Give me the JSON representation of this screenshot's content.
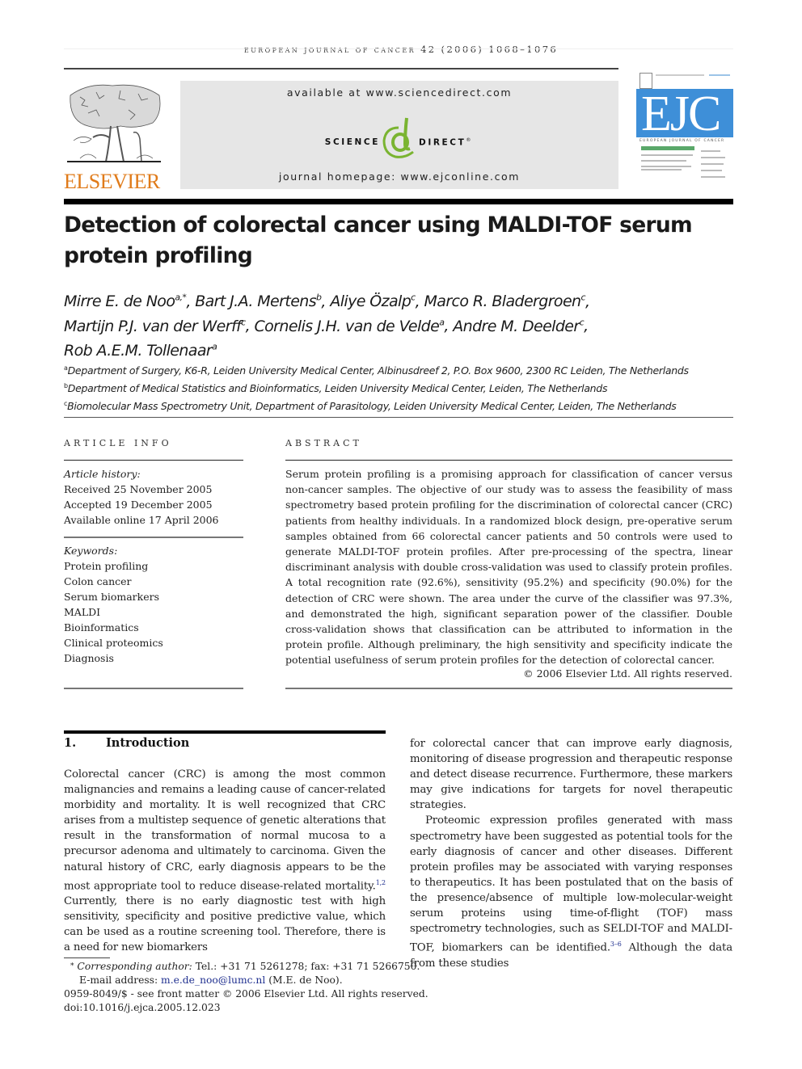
{
  "header": {
    "running_head": "European Journal of Cancer",
    "running_head_citation": "42 (2006) 1068–1076",
    "publisher_logo_text": "ELSEVIER",
    "banner": {
      "available_at": "available at www.sciencedirect.com",
      "sd_left": "SCIENCE",
      "sd_right": "DIRECT",
      "sd_registered": "®",
      "journal_homepage": "journal homepage: www.ejconline.com"
    },
    "cover": {
      "abbrev": "EJC",
      "name": "EUROPEAN JOURNAL OF CANCER"
    }
  },
  "article": {
    "title": "Detection of colorectal cancer using MALDI-TOF serum protein profiling",
    "authors": [
      {
        "name": "Mirre E. de Noo",
        "sup": "a,*"
      },
      {
        "name": "Bart J.A. Mertens",
        "sup": "b"
      },
      {
        "name": "Aliye Özalp",
        "sup": "c"
      },
      {
        "name": "Marco R. Bladergroen",
        "sup": "c"
      },
      {
        "name": "Martijn P.J. van der Werff",
        "sup": "c"
      },
      {
        "name": "Cornelis J.H. van de Velde",
        "sup": "a"
      },
      {
        "name": "Andre M. Deelder",
        "sup": "c"
      },
      {
        "name": "Rob A.E.M. Tollenaar",
        "sup": "a"
      }
    ],
    "affiliations": [
      {
        "mark": "a",
        "text": "Department of Surgery, K6-R, Leiden University Medical Center, Albinusdreef 2, P.O. Box 9600, 2300 RC Leiden, The Netherlands"
      },
      {
        "mark": "b",
        "text": "Department of Medical Statistics and Bioinformatics, Leiden University Medical Center, Leiden, The Netherlands"
      },
      {
        "mark": "c",
        "text": "Biomolecular Mass Spectrometry Unit, Department of Parasitology, Leiden University Medical Center, Leiden, The Netherlands"
      }
    ]
  },
  "article_info": {
    "heading": "ARTICLE INFO",
    "history_label": "Article history:",
    "history": [
      "Received 25 November 2005",
      "Accepted 19 December 2005",
      "Available online 17 April 2006"
    ],
    "keywords_label": "Keywords:",
    "keywords": [
      "Protein profiling",
      "Colon cancer",
      "Serum biomarkers",
      "MALDI",
      "Bioinformatics",
      "Clinical proteomics",
      "Diagnosis"
    ]
  },
  "abstract": {
    "heading": "ABSTRACT",
    "text": "Serum protein profiling is a promising approach for classification of cancer versus non-cancer samples. The objective of our study was to assess the feasibility of mass spectrometry based protein profiling for the discrimination of colorectal cancer (CRC) patients from healthy individuals. In a randomized block design, pre-operative serum samples obtained from 66 colorectal cancer patients and 50 controls were used to generate MALDI-TOF protein profiles. After pre-processing of the spectra, linear discriminant analysis with double cross-validation was used to classify protein profiles. A total recognition rate (92.6%), sensitivity (95.2%) and specificity (90.0%) for the detection of CRC were shown. The area under the curve of the classifier was 97.3%, and demonstrated the high, significant separation power of the classifier. Double cross-validation shows that classification can be attributed to information in the protein profile. Although preliminary, the high sensitivity and specificity indicate the potential usefulness of serum protein profiles for the detection of colorectal cancer.",
    "copyright": "© 2006 Elsevier Ltd. All rights reserved."
  },
  "introduction": {
    "number": "1.",
    "heading": "Introduction",
    "left_col": {
      "p1_a": "Colorectal cancer (CRC) is among the most common malignancies and remains a leading cause of cancer-related morbidity and mortality. It is well recognized that CRC arises from a multistep sequence of genetic alterations that result in the transformation of normal mucosa to a precursor adenoma and ultimately to carcinoma. Given the natural history of CRC, early diagnosis appears to be the most appropriate tool to reduce disease-related mortality.",
      "ref1": "1,2",
      "p1_b": " Currently, there is no early diagnostic test with high sensitivity, specificity and positive predictive value, which can be used as a routine screening tool. Therefore, there is a need for new biomarkers"
    },
    "right_col": {
      "p1_cont": "for colorectal cancer that can improve early diagnosis, monitoring of disease progression and therapeutic response and detect disease recurrence. Furthermore, these markers may give indications for targets for novel therapeutic strategies.",
      "p2_a": "Proteomic expression profiles generated with mass spectrometry have been suggested as potential tools for the early diagnosis of cancer and other diseases. Different protein profiles may be associated with varying responses to therapeutics. It has been postulated that on the basis of the presence/absence of multiple low-molecular-weight serum proteins using time-of-flight (TOF) mass spectrometry technologies, such as SELDI-TOF and MALDI-TOF, biomarkers can be identified.",
      "ref2": "3–6",
      "p2_b": " Although the data from these studies"
    }
  },
  "footnotes": {
    "mark": "*",
    "corr_label": "Corresponding author:",
    "corr_text": " Tel.: +31 71 5261278; fax: +31 71 5266750.",
    "email_label": "E-mail address: ",
    "email": "m.e.de_noo@lumc.nl",
    "email_after": " (M.E. de Noo).",
    "issn_line": "0959-8049/$ - see front matter © 2006 Elsevier Ltd. All rights reserved.",
    "doi": "doi:10.1016/j.ejca.2005.12.023"
  },
  "colors": {
    "elsevier_orange": "#e07b1a",
    "sciencedirect_green": "#7ab431",
    "ejc_blue": "#3e8fd8",
    "link_blue": "#1f2f8f"
  }
}
